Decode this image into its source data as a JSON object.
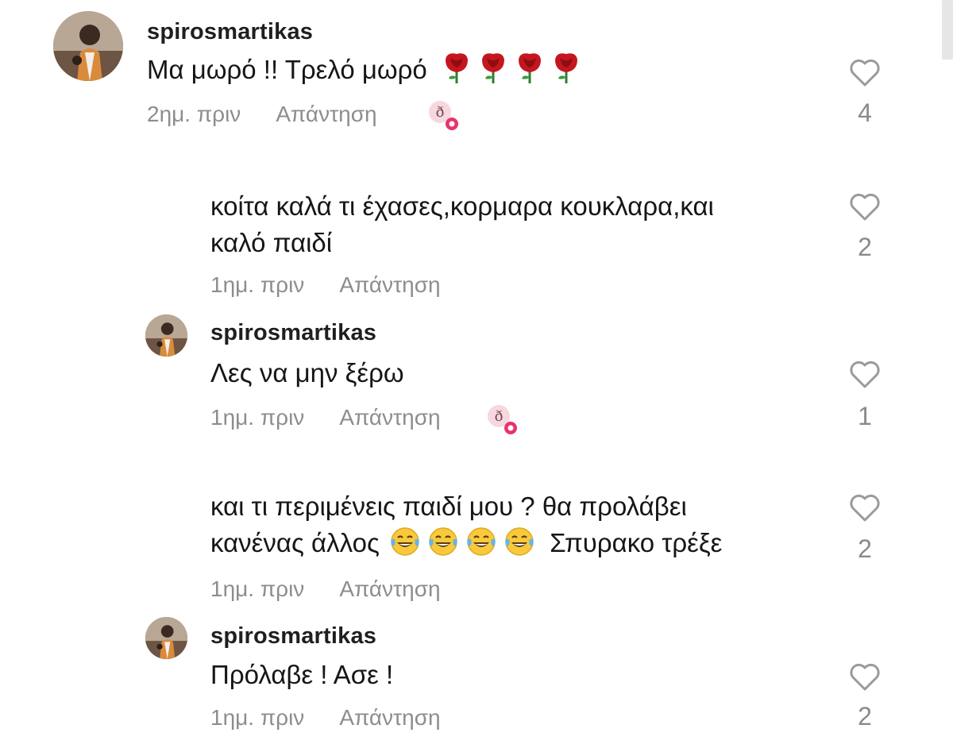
{
  "comments": [
    {
      "username": "spirosmartikas",
      "text": "Μα μωρό !! Τρελό μωρό",
      "emoji": "rose-emoji x4",
      "time": "2ημ. πριν",
      "reply": "Απάντηση",
      "likes": "4",
      "creator_liked": true
    },
    {
      "text_line1": "κοίτα καλά τι έχασες,κορμαρα κουκλαρα,και",
      "text_line2": "καλό παιδί",
      "time": "1ημ. πριν",
      "reply": "Απάντηση",
      "likes": "2"
    },
    {
      "username": "spirosmartikas",
      "text": "Λες να μην ξέρω",
      "time": "1ημ. πριν",
      "reply": "Απάντηση",
      "likes": "1",
      "creator_liked": true
    },
    {
      "text_line1": "και τι περιμένεις παιδί μου ? θα προλάβει",
      "text_line2_start": "κανένας άλλος",
      "emoji": "laughing-tears-emoji x4",
      "text_line2_end": "Σπυρακο τρέξε",
      "time": "1ημ. πριν",
      "reply": "Απάντηση",
      "likes": "2"
    },
    {
      "username": "spirosmartikas",
      "text": "Πρόλαβε ! Ασε !",
      "time": "1ημ. πριν",
      "reply": "Απάντηση",
      "likes": "2"
    }
  ],
  "colors": {
    "text": "#161616",
    "meta": "#8d8d8d",
    "badge": "#e8336b"
  }
}
